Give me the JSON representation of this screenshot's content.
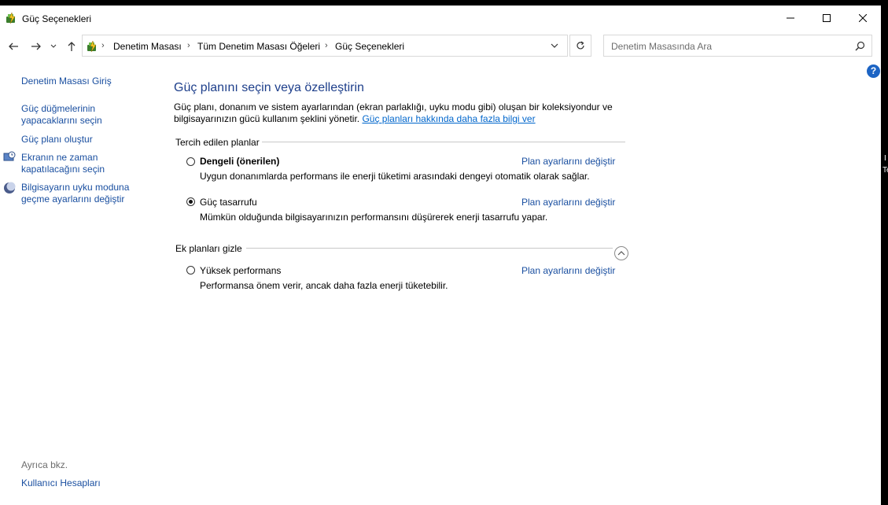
{
  "window": {
    "title": "Güç Seçenekleri"
  },
  "addressbar": {
    "crumbs": [
      "Denetim Masası",
      "Tüm Denetim Masası Öğeleri",
      "Güç Seçenekleri"
    ]
  },
  "search": {
    "placeholder": "Denetim Masasında Ara"
  },
  "help": {
    "label": "?"
  },
  "sidebar": {
    "home": "Denetim Masası Giriş",
    "items": [
      {
        "label": "Güç düğmelerinin yapacaklarını seçin"
      },
      {
        "label": "Güç planı oluştur"
      },
      {
        "label": "Ekranın ne zaman kapatılacağını seçin"
      },
      {
        "label": "Bilgisayarın uyku moduna geçme ayarlarını değiştir"
      }
    ],
    "see_also": "Ayrıca bkz.",
    "see_also_link": "Kullanıcı Hesapları"
  },
  "main": {
    "heading": "Güç planını seçin veya özelleştirin",
    "intro_text": "Güç planı, donanım ve sistem ayarlarından (ekran parlaklığı, uyku modu gibi) oluşan bir koleksiyondur ve bilgisayarınızın gücü kullanım şeklini yönetir.",
    "intro_link": "Güç planları hakkında daha fazla bilgi ver",
    "preferred_title": "Tercih edilen planlar",
    "extra_title": "Ek planları gizle",
    "change_label": "Plan ayarlarını değiştir",
    "plans": [
      {
        "name": "Dengeli (önerilen)",
        "desc": "Uygun donanımlarda performans ile enerji tüketimi arasındaki dengeyi otomatik olarak sağlar.",
        "selected": false
      },
      {
        "name": "Güç tasarrufu",
        "desc": "Mümkün olduğunda bilgisayarınızın performansını düşürerek enerji tasarrufu yapar.",
        "selected": true
      },
      {
        "name": "Yüksek performans",
        "desc": "Performansa önem verir, ancak daha fazla enerji tüketebilir.",
        "selected": false
      }
    ]
  },
  "edge": {
    "glyph1": "I",
    "glyph2": "Te"
  }
}
